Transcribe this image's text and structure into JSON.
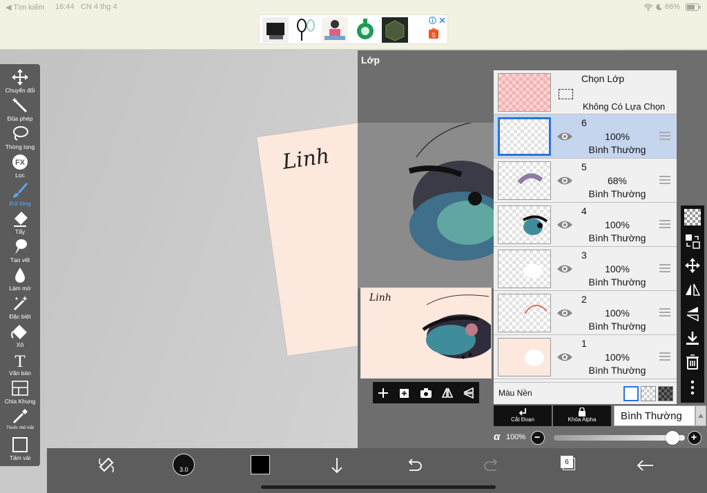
{
  "status": {
    "back": "◀ Tìm kiếm",
    "time": "16:44",
    "date": "CN 4 thg 4",
    "battery": "66%",
    "icons": [
      "wifi-icon",
      "moon-icon",
      "battery-icon"
    ]
  },
  "ad": {
    "close_icons": [
      "info-icon",
      "close-icon"
    ]
  },
  "canvas": {
    "signature": "Linh"
  },
  "tools": [
    {
      "label": "Chuyển đổi",
      "icon": "move-arrows-icon"
    },
    {
      "label": "Đũa phép",
      "icon": "magic-wand-icon"
    },
    {
      "label": "Thòng lọng",
      "icon": "lasso-icon"
    },
    {
      "label": "Lọc",
      "icon": "fx-filter-icon"
    },
    {
      "label": "Bút lông",
      "icon": "brush-icon",
      "active": true
    },
    {
      "label": "Tẩy",
      "icon": "eraser-icon"
    },
    {
      "label": "Tạo vết",
      "icon": "smudge-icon"
    },
    {
      "label": "Làm mờ",
      "icon": "blur-drop-icon"
    },
    {
      "label": "Đặc biệt",
      "icon": "special-brush-icon"
    },
    {
      "label": "Xô",
      "icon": "bucket-icon"
    },
    {
      "label": "Văn bản",
      "icon": "text-icon"
    },
    {
      "label": "Chia Khung",
      "icon": "frame-divider-icon"
    },
    {
      "label": "Thuốc nhỏ mắt",
      "icon": "eyedropper-icon"
    },
    {
      "label": "Tấm vải",
      "icon": "canvas-icon"
    }
  ],
  "layer_panel": {
    "title": "Lớp",
    "preview_signature": "Linh",
    "selection": {
      "title": "Chọn Lớp",
      "subtitle": "Không Có Lựa Chọn"
    },
    "layers": [
      {
        "num": "6",
        "opacity": "100%",
        "mode": "Bình Thường",
        "selected": true
      },
      {
        "num": "5",
        "opacity": "68%",
        "mode": "Bình Thường"
      },
      {
        "num": "4",
        "opacity": "100%",
        "mode": "Bình Thường"
      },
      {
        "num": "3",
        "opacity": "100%",
        "mode": "Bình Thường"
      },
      {
        "num": "2",
        "opacity": "100%",
        "mode": "Bình Thường"
      },
      {
        "num": "1",
        "opacity": "100%",
        "mode": "Bình Thường"
      }
    ],
    "background_label": "Màu Nền",
    "clip_label": "Cắt Đoạn",
    "alpha_lock_label": "Khóa Alpha",
    "blend_mode": "Bình Thường",
    "alpha_symbol": "α",
    "alpha_value": "100%",
    "alpha_level": 0.95
  },
  "bottom": {
    "brush_size": "3.0",
    "layer_count": "6"
  },
  "colors": {
    "accent": "#2c72d8",
    "panel": "#6e6e6e",
    "toolbar": "#5b5b5b",
    "active_tool": "#5aa9ff"
  }
}
